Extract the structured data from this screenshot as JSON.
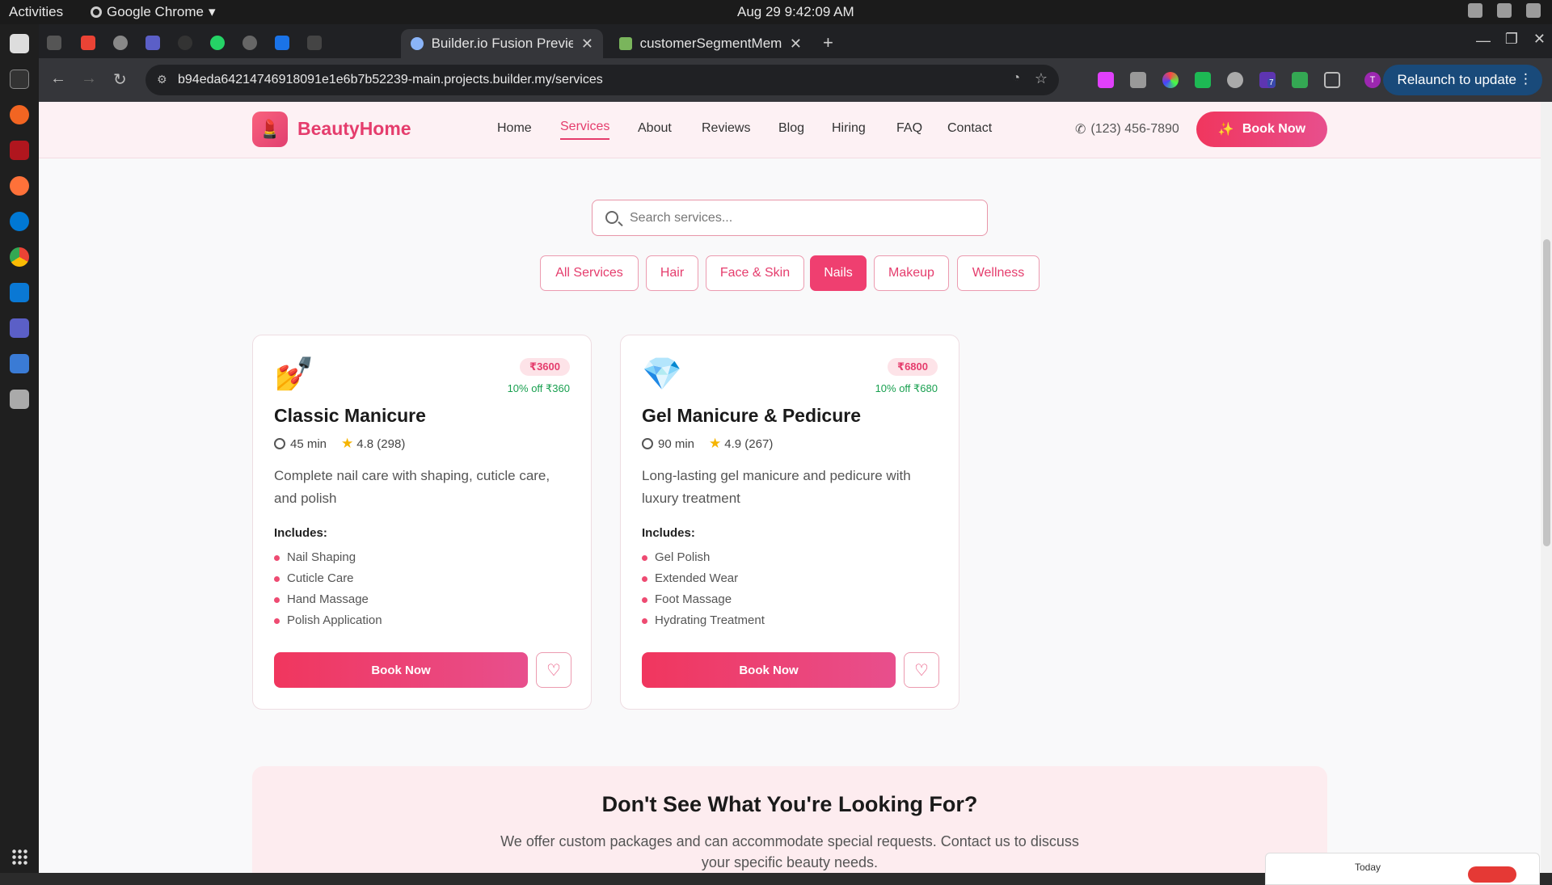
{
  "system": {
    "activities": "Activities",
    "app_name": "Google Chrome",
    "clock": "Aug 29  9:42:09 AM"
  },
  "browser": {
    "tabs": [
      {
        "title": "Builder.io Fusion Previev"
      },
      {
        "title": "customerSegmentMemb"
      }
    ],
    "url": "b94eda64214746918091e1e6b7b52239-main.projects.builder.my/services",
    "relaunch": "Relaunch to update",
    "profile_initial": "T",
    "extension_badge": "7"
  },
  "site": {
    "brand": "BeautyHome",
    "nav": [
      "Home",
      "Services",
      "About",
      "Reviews",
      "Blog",
      "Hiring",
      "FAQ",
      "Contact"
    ],
    "active_nav": "Services",
    "phone": "(123) 456-7890",
    "book_now": "Book Now",
    "search_placeholder": "Search services...",
    "filters": [
      "All Services",
      "Hair",
      "Face & Skin",
      "Nails",
      "Makeup",
      "Wellness"
    ],
    "active_filter": "Nails",
    "services": [
      {
        "emoji": "💅",
        "price": "₹3600",
        "discount": "10% off ₹360",
        "title": "Classic Manicure",
        "duration": "45 min",
        "rating": "4.8 (298)",
        "description": "Complete nail care with shaping, cuticle care, and polish",
        "includes_label": "Includes:",
        "includes": [
          "Nail Shaping",
          "Cuticle Care",
          "Hand Massage",
          "Polish Application"
        ],
        "book": "Book Now"
      },
      {
        "emoji": "💎",
        "price": "₹6800",
        "discount": "10% off ₹680",
        "title": "Gel Manicure & Pedicure",
        "duration": "90 min",
        "rating": "4.9 (267)",
        "description": "Long-lasting gel manicure and pedicure with luxury treatment",
        "includes_label": "Includes:",
        "includes": [
          "Gel Polish",
          "Extended Wear",
          "Foot Massage",
          "Hydrating Treatment"
        ],
        "book": "Book Now"
      }
    ],
    "cta": {
      "heading": "Don't See What You're Looking For?",
      "text": "We offer custom packages and can accommodate special requests. Contact us to discuss your specific beauty needs."
    }
  },
  "popup": {
    "label": "Today"
  },
  "colors": {
    "brand": "#e53d6d",
    "accent_gradient_start": "#f0365e",
    "accent_gradient_end": "#e84f8d",
    "discount": "#19a050"
  }
}
